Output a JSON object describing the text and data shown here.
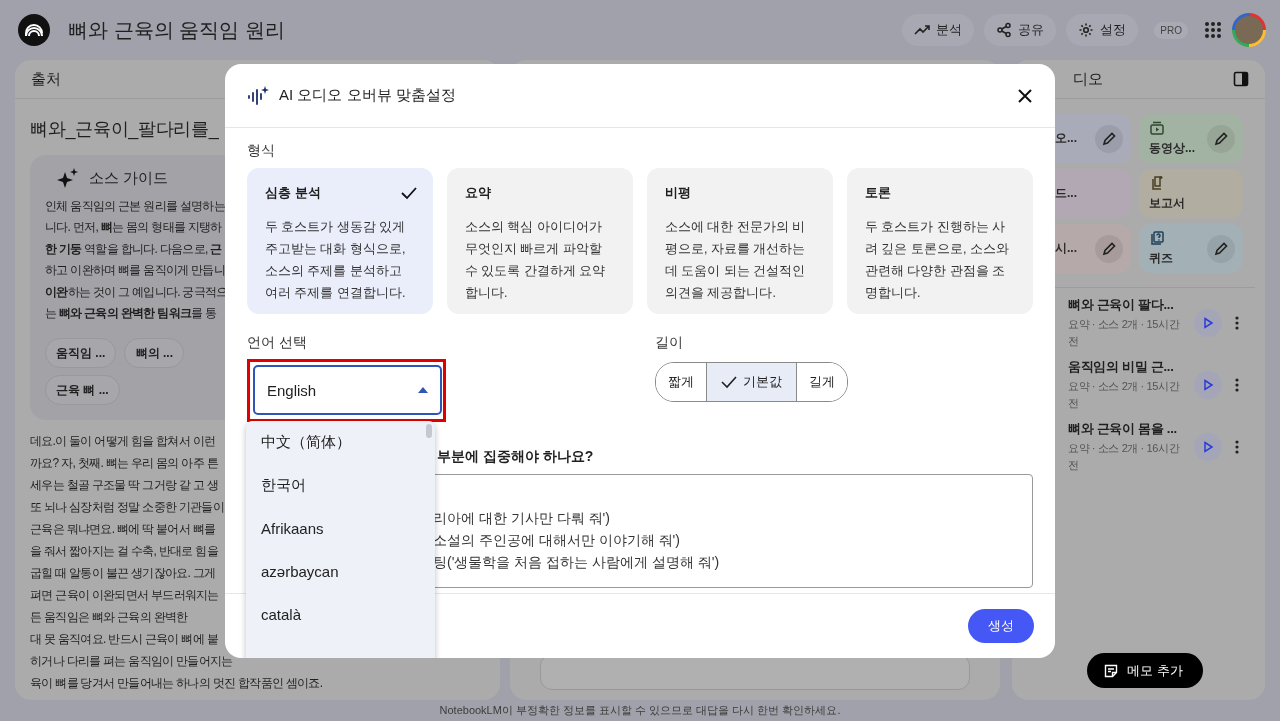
{
  "app_bar": {
    "title": "뼈와 근육의 움직임 원리",
    "actions": [
      {
        "kind": "analytics",
        "label": "분석"
      },
      {
        "kind": "share",
        "label": "공유"
      },
      {
        "kind": "settings",
        "label": "설정"
      }
    ],
    "badge": "PRO"
  },
  "sources_panel": {
    "title": "출처",
    "source_title": "뼈와_근육이_팔다리를_",
    "guide": {
      "title": "소스 가이드",
      "summary_lines": [
        "인체 움직임의 근본 원리를 설명하는",
        "니다. 먼저, **뼈**는 몸의 형태를 지탱하",
        "**한 기둥** 역할을 합니다. 다음으로, **근**",
        "하고 이완하며 뼈를 움직이게 만듭니",
        "**이완**하는 것이 그 예입니다. 궁극적으",
        "는 **뼈와 근육의 완벽한 팀워크**를 통"
      ],
      "topics": [
        "움직임 ...",
        "뼈의 ...",
        "근육 뼈 ..."
      ]
    },
    "transcript_lines": [
      "데요.이 둘이 어떻게 힘을 합쳐서 이런",
      "까요? 자, 첫째. 뼈는 우리 몸의 아주 튼",
      "세우는 철골 구조물 딱 그거랑 같 고 생",
      "또 뇌나 심장처럼 정말 소중한 기관들이",
      "근육은 뭐냐면요. 뼈에 딱 붙어서 뼈를",
      "을 줘서 짧아지는 걸 수축, 반대로 힘을",
      "굽힐 때 알통이 불끈 생기잖아요. 그게",
      "펴면 근육이 이완되면서 부드러워지는",
      "든 움직임은 뼈와 근육의 완벽한",
      "대 못 움직여요. 반드시 근육이 뼈에 붙",
      "히거나 다리를 펴는 움직임이 만들어지는",
      "육이 뼈를 당겨서 만들어내는 하나의 멋진 합작품인 셈이죠."
    ]
  },
  "studio_panel": {
    "title": "디오",
    "tiles": [
      {
        "label": "오...",
        "kind": "plain",
        "editable": true,
        "color": "#a9abb9"
      },
      {
        "label": "동영상...",
        "kind": "video",
        "editable": true,
        "color": "#a3b3a3"
      },
      {
        "label": "드...",
        "kind": "plain",
        "editable": false,
        "color": "#b2a8b3"
      },
      {
        "label": "보고서",
        "kind": "report",
        "editable": false,
        "color": "#b1ada0"
      },
      {
        "label": "시...",
        "kind": "plain",
        "editable": true,
        "color": "#b6a9a9"
      },
      {
        "label": "퀴즈",
        "kind": "quiz",
        "editable": true,
        "color": "#a3b1b7"
      }
    ],
    "notes": [
      {
        "title": "뼈와 근육이 팔다...",
        "meta": "요약 · 소스 2개 · 15시간 전"
      },
      {
        "title": "움직임의 비밀 근...",
        "meta": "요약 · 소스 2개 · 15시간 전"
      },
      {
        "title": "뼈와 근육이 몸을 ...",
        "meta": "요약 · 소스 2개 · 16시간 전"
      }
    ],
    "add_note": "메모 추가"
  },
  "dialog": {
    "title": "AI 오디오 오버뷰 맞춤설정",
    "format_label": "형식",
    "formats": [
      {
        "title": "심층 분석",
        "description": "두 호스트가 생동감 있게 주고받는 대화 형식으로, 소스의 주제를 분석하고 여러 주제를 연결합니다.",
        "selected": true
      },
      {
        "title": "요약",
        "description": "소스의 핵심 아이디어가 무엇인지 빠르게 파악할 수 있도록 간결하게 요약합니다.",
        "selected": false
      },
      {
        "title": "비평",
        "description": "소스에 대한 전문가의 비평으로, 자료를 개선하는 데 도움이 되는 건설적인 의견을 제공합니다.",
        "selected": false
      },
      {
        "title": "토론",
        "description": "두 호스트가 진행하는 사려 깊은 토론으로, 소스와 관련해 다양한 관점을 조명합니다.",
        "selected": false
      }
    ],
    "language": {
      "label": "언어 선택",
      "value": "English",
      "highlighted": true,
      "open": true,
      "options": [
        "中文（简体）",
        "한국어",
        "Afrikaans",
        "azərbaycan",
        "català"
      ]
    },
    "length": {
      "label": "길이",
      "options": [
        {
          "label": "짧게",
          "selected": false
        },
        {
          "label": "기본값",
          "selected": true
        },
        {
          "label": "길게",
          "selected": false
        }
      ]
    },
    "focus": {
      "label": "부분에 집중해야 하나요?",
      "placeholder_lines": [
        "리아에 대한 기사만 다뤄 줘')",
        "소설의 주인공에 대해서만 이야기해 줘')",
        "팅('생물학을 처음 접하는 사람에게 설명해 줘')"
      ]
    },
    "generate": "생성"
  },
  "footer": "NotebookLM이 부정확한 정보를 표시할 수 있으므로 대답을 다시 한번 확인하세요."
}
